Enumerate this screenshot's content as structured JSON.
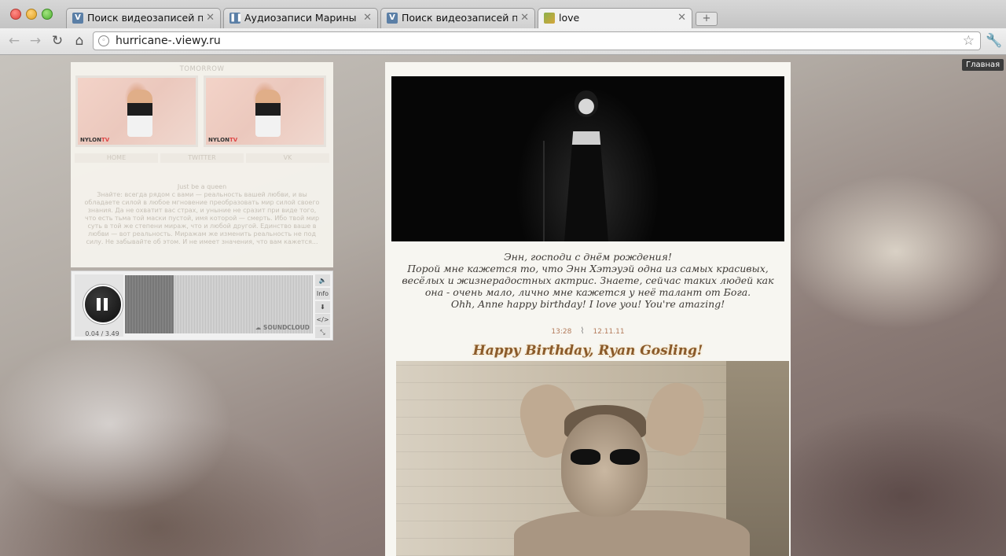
{
  "browser": {
    "tabs": [
      {
        "title": "Поиск видеозаписей по запросу",
        "favicon": "vk-icon",
        "active": false
      },
      {
        "title": "Аудиозаписи Марины Декаты",
        "favicon": "audio-pause-icon",
        "active": false
      },
      {
        "title": "Поиск видеозаписей по запросу",
        "favicon": "vk-icon",
        "active": false
      },
      {
        "title": "love",
        "favicon": "page-favicon",
        "active": true
      }
    ],
    "url": "hurricane-.viewy.ru",
    "tooltip": "Главная"
  },
  "sidebar": {
    "heading": "TOMORROW",
    "photos": [
      {
        "brand": "NYLON",
        "brand_accent": "TV"
      },
      {
        "brand": "NYLON",
        "brand_accent": "TV"
      }
    ],
    "nav": [
      "HOME",
      "TWITTER",
      "VK"
    ],
    "quote_title": "Just be a queen",
    "quote_text": "Знайте: всегда рядом с вами — реальность вашей любви, и вы обладаете силой в любое мгновение преобразовать мир силой своего знания. Да не охватит вас страх, и уныние не сразит при виде того, что есть тьма той маски пустой, имя которой — смерть. Ибо твой мир суть в той же степени мираж, что и любой другой. Единство ваше в любви — вот реальность. Миражам же изменить реальность не под силу. Не забывайте об этом. И не имеет значения, что вам кажется..."
  },
  "player": {
    "time": "0.04 / 3.49",
    "progress": 0.02,
    "info_label": "Info",
    "brand": "SOUNDCLOUD",
    "state": "playing"
  },
  "post1": {
    "lines": [
      "Энн, господи с днём рождения!",
      "Порой мне кажется то, что Энн Хэтэуэй одна из самых красивых, весёлых и жизнерадостных актрис. Знаете, сейчас таких людей как она - очень мало, лично мне кажется у неё талант от Бога.",
      "Ohh, Anne happy birthday! I love you! You're amazing!"
    ],
    "time": "13:28",
    "date": "12.11.11"
  },
  "post2": {
    "title": "Happy Birthday, Ryan Gosling!"
  },
  "colors": {
    "accent_meta": "#b37a5a",
    "title_brown": "#8a5a2a",
    "panel_bg": "#f7f6f1"
  }
}
